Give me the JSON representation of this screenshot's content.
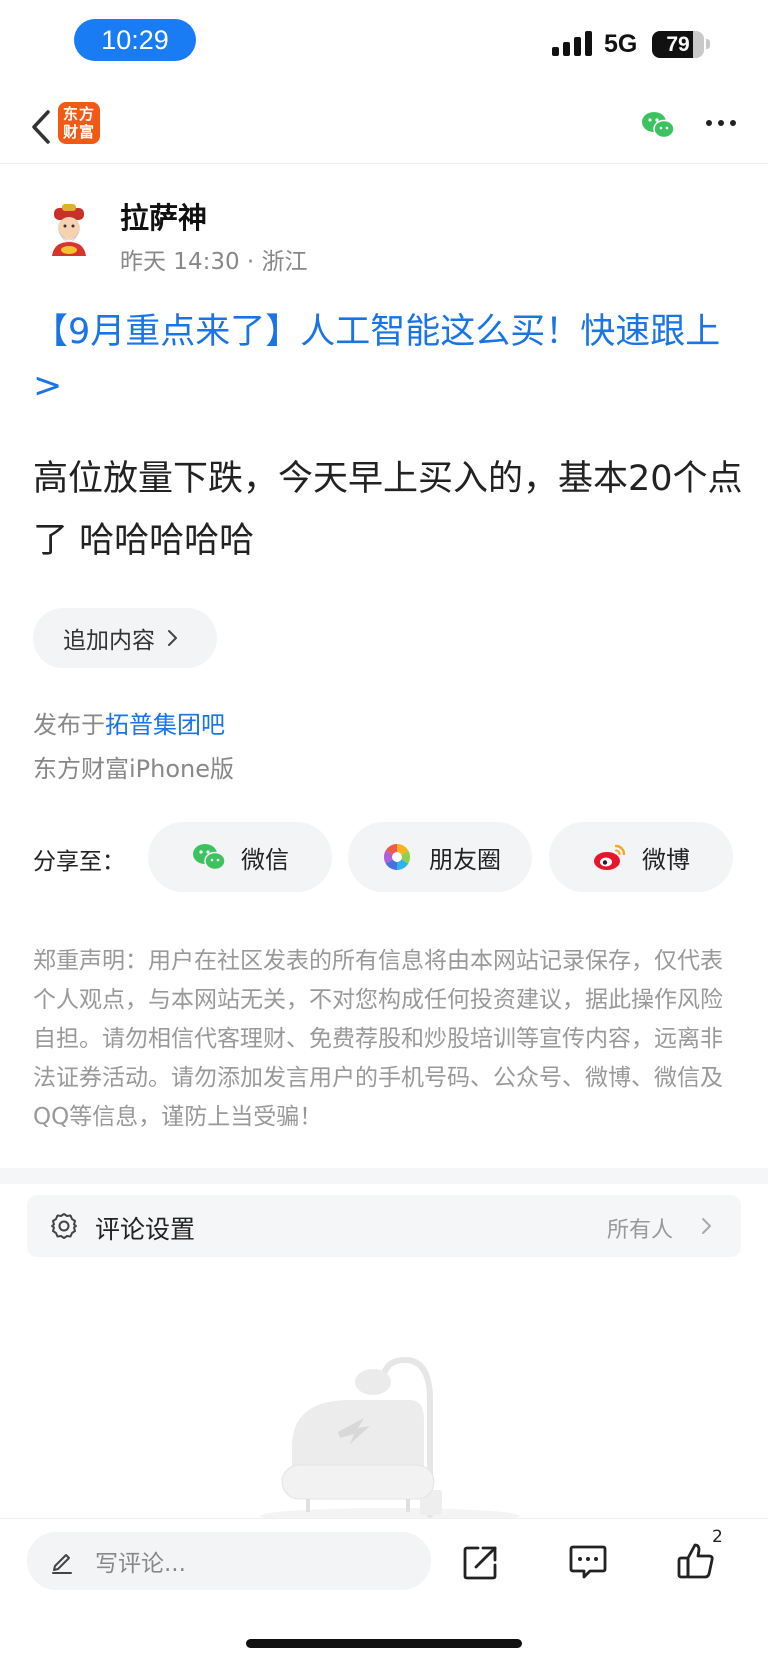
{
  "status_bar": {
    "time": "10:29",
    "network": "5G",
    "battery_level": "79",
    "battery_fraction": 0.79
  },
  "nav": {
    "app_logo_line1": "东方",
    "app_logo_line2": "财富"
  },
  "author": {
    "name": "拉萨神",
    "meta": "昨天 14:30 · 浙江"
  },
  "post": {
    "promo_link": "【9月重点来了】人工智能这么买！快速跟上>",
    "body": "高位放量下跌，今天早上买入的，基本20个点了 哈哈哈哈哈",
    "append_label": "追加内容",
    "posted_in_prefix": "发布于",
    "posted_in_bar": "拓普集团吧",
    "client": "东方财富iPhone版"
  },
  "share": {
    "label": "分享至：",
    "targets": [
      {
        "label": "微信",
        "icon": "wechat-icon"
      },
      {
        "label": "朋友圈",
        "icon": "moments-icon"
      },
      {
        "label": "微博",
        "icon": "weibo-icon"
      }
    ]
  },
  "disclaimer": "郑重声明：用户在社区发表的所有信息将由本网站记录保存，仅代表个人观点，与本网站无关，不对您构成任何投资建议，据此操作风险自担。请勿相信代客理财、免费荐股和炒股培训等宣传内容，远离非法证券活动。请勿添加发言用户的手机号码、公众号、微博、微信及QQ等信息，谨防上当受骗！",
  "comment_settings": {
    "label": "评论设置",
    "value": "所有人"
  },
  "bottom_bar": {
    "comment_placeholder": "写评论...",
    "like_count": "2"
  },
  "colors": {
    "accent_blue": "#1a74e6",
    "brand_orange": "#f05a14",
    "time_pill": "#1a7cf5"
  }
}
